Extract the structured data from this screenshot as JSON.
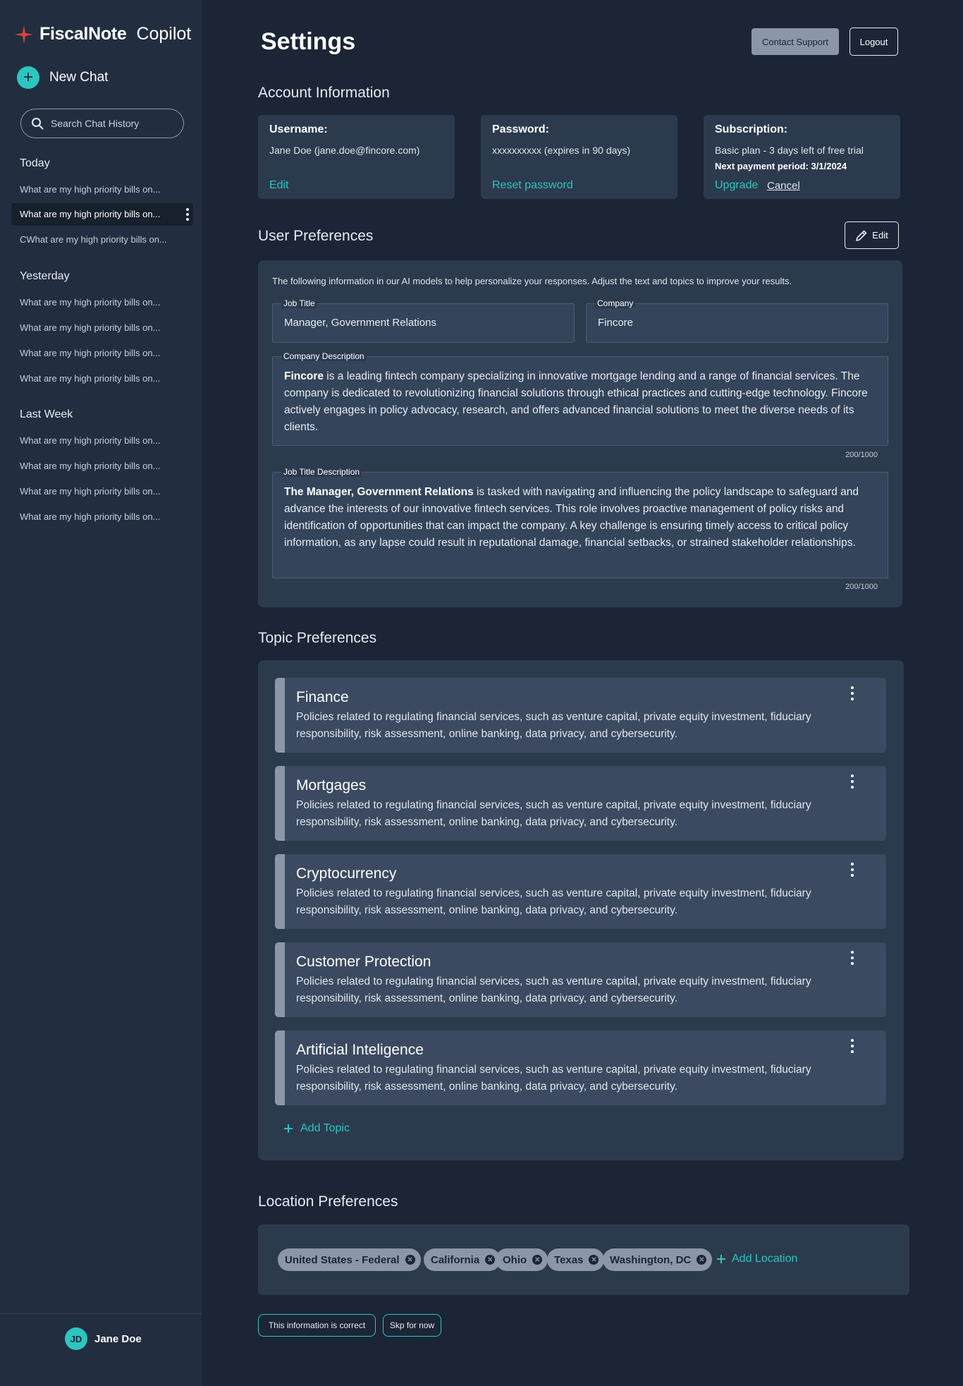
{
  "brand": {
    "name": "FiscalNote",
    "product": "Copilot"
  },
  "sidebar": {
    "new_chat": "New Chat",
    "search_placeholder": "Search Chat History",
    "groups": [
      {
        "title": "Today",
        "items": [
          "What are my high priority bills on...",
          "What are my high priority bills on...",
          "CWhat are my high priority bills on..."
        ]
      },
      {
        "title": "Yesterday",
        "items": [
          "What are my high priority bills on...",
          "What are my high priority bills on...",
          "What are my high priority bills on...",
          "What are my high priority bills on..."
        ]
      },
      {
        "title": "Last Week",
        "items": [
          "What are my high priority bills on...",
          "What are my high priority bills on...",
          "What are my high priority bills on...",
          "What are my high priority bills on..."
        ]
      }
    ],
    "user": {
      "initials": "JD",
      "name": "Jane Doe"
    }
  },
  "header": {
    "title": "Settings",
    "contact_support": "Contact Support",
    "logout": "Logout"
  },
  "account": {
    "section_title": "Account Information",
    "username": {
      "label": "Username:",
      "value": "Jane Doe (jane.doe@fincore.com)",
      "action": "Edit"
    },
    "password": {
      "label": "Password:",
      "value": "xxxxxxxxxx (expires in 90 days)",
      "action": "Reset password"
    },
    "subscription": {
      "label": "Subscription:",
      "value": "Basic plan - 3 days left of free trial",
      "next_payment": "Next payment period: 3/1/2024",
      "upgrade": "Upgrade",
      "cancel": "Cancel"
    }
  },
  "user_prefs": {
    "section_title": "User Preferences",
    "edit": "Edit",
    "intro": "The following information in our AI models to help personalize your responses. Adjust the text and topics to improve your results.",
    "job_title": {
      "label": "Job Title",
      "value": "Manager, Government Relations"
    },
    "company": {
      "label": "Company",
      "value": "Fincore"
    },
    "company_description": {
      "label": "Company Description",
      "bold": "Fincore",
      "text": " is a leading fintech company specializing in innovative mortgage lending and a range of financial services. The company is dedicated to revolutionizing financial solutions through ethical practices and cutting-edge technology. Fincore actively engages in policy advocacy, research, and offers advanced financial solutions to meet the diverse needs of its clients.",
      "counter": "200/1000"
    },
    "job_title_description": {
      "label": "Job Title Description",
      "bold": "The Manager, Government Relations",
      "text": " is tasked with navigating and influencing the policy landscape to safeguard and advance the interests of our innovative fintech services. This role involves proactive management of policy risks and identification of opportunities that can impact the company. A key challenge is ensuring timely access to critical policy information, as any lapse could result in reputational damage, financial setbacks, or strained stakeholder relationships.",
      "counter": "200/1000"
    }
  },
  "topics": {
    "section_title": "Topic Preferences",
    "items": [
      {
        "name": "Finance",
        "description": "Policies related to regulating financial services, such as venture capital, private equity investment, fiduciary responsibility, risk assessment, online banking, data privacy, and cybersecurity."
      },
      {
        "name": "Mortgages",
        "description": "Policies related to regulating financial services, such as venture capital, private equity investment, fiduciary responsibility, risk assessment, online banking, data privacy, and cybersecurity."
      },
      {
        "name": "Cryptocurrency",
        "description": "Policies related to regulating financial services, such as venture capital, private equity investment, fiduciary responsibility, risk assessment, online banking, data privacy, and cybersecurity."
      },
      {
        "name": "Customer Protection",
        "description": "Policies related to regulating financial services, such as venture capital, private equity investment, fiduciary responsibility, risk assessment, online banking, data privacy, and cybersecurity."
      },
      {
        "name": "Artificial Inteligence",
        "description": "Policies related to regulating financial services, such as venture capital, private equity investment, fiduciary responsibility, risk assessment, online banking, data privacy, and cybersecurity."
      }
    ],
    "add": "Add Topic"
  },
  "locations": {
    "section_title": "Location Preferences",
    "items": [
      "United States - Federal",
      "California",
      "Ohio",
      "Texas",
      "Washington, DC"
    ],
    "add": "Add Location"
  },
  "footer_buttons": {
    "confirm": "This information is correct",
    "skip": "Skp for now"
  },
  "colors": {
    "accent": "#2cc5c0",
    "background": "#1b2535",
    "sidebar": "#222e40",
    "card": "#2c3a4e",
    "brand_star": "#e0433f"
  }
}
